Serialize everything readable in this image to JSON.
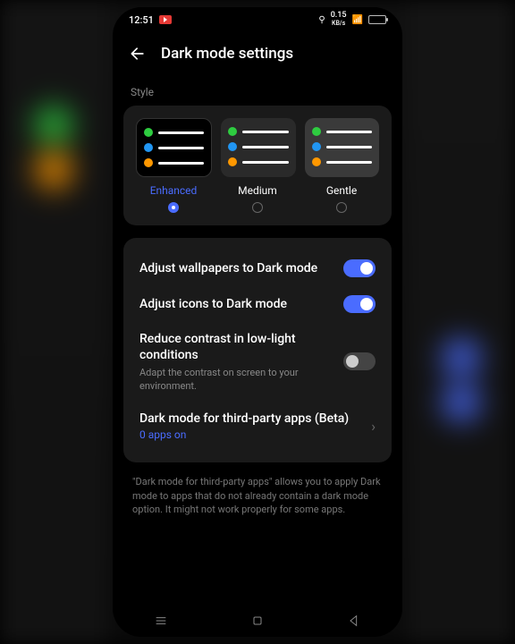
{
  "statusbar": {
    "time": "12:51",
    "net_speed": "0.15",
    "net_unit": "KB/s"
  },
  "header": {
    "title": "Dark mode settings"
  },
  "style": {
    "section_label": "Style",
    "options": [
      {
        "label": "Enhanced",
        "selected": true
      },
      {
        "label": "Medium",
        "selected": false
      },
      {
        "label": "Gentle",
        "selected": false
      }
    ]
  },
  "settings": {
    "wallpapers": {
      "title": "Adjust wallpapers to Dark mode",
      "on": true
    },
    "icons": {
      "title": "Adjust icons to Dark mode",
      "on": true
    },
    "contrast": {
      "title": "Reduce contrast in low-light conditions",
      "subtitle": "Adapt the contrast on screen to your environment.",
      "on": false
    },
    "thirdparty": {
      "title": "Dark mode for third-party apps (Beta)",
      "link": "0 apps on"
    }
  },
  "footnote": "\"Dark mode for third-party apps\" allows you to apply Dark mode to apps that do not already contain a dark mode option. It might not work properly for some apps."
}
